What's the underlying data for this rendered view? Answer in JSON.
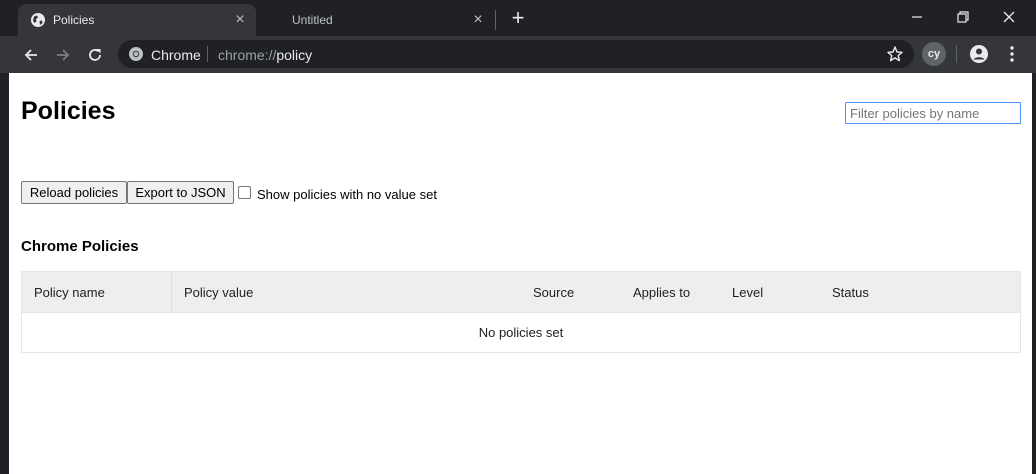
{
  "tabs": [
    {
      "title": "Policies",
      "active": true
    },
    {
      "title": "Untitled",
      "active": false
    }
  ],
  "toolbar": {
    "site_chip": "Chrome",
    "url_scheme": "chrome://",
    "url_host": "policy",
    "extension_label": "cy"
  },
  "page": {
    "title": "Policies",
    "filter_placeholder": "Filter policies by name",
    "reload_button": "Reload policies",
    "export_button": "Export to JSON",
    "show_unset_label": "Show policies with no value set",
    "section_title": "Chrome Policies",
    "table": {
      "columns": [
        "Policy name",
        "Policy value",
        "Source",
        "Applies to",
        "Level",
        "Status"
      ],
      "empty_message": "No policies set"
    }
  },
  "colors": {
    "frame": "#202124",
    "toolbar": "#35363a",
    "focus": "#4d90fe"
  }
}
